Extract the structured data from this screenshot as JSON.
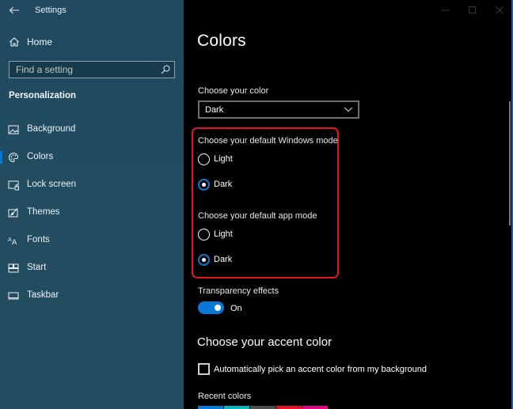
{
  "window": {
    "title": "Settings",
    "controls": {
      "minimize": "minimize",
      "maximize": "maximize",
      "close": "close"
    }
  },
  "sidebar": {
    "home_label": "Home",
    "search": {
      "placeholder": "Find a setting",
      "value": ""
    },
    "section_title": "Personalization",
    "items": [
      {
        "label": "Background",
        "icon": "picture-icon",
        "selected": false
      },
      {
        "label": "Colors",
        "icon": "palette-icon",
        "selected": true
      },
      {
        "label": "Lock screen",
        "icon": "lock-screen-icon",
        "selected": false
      },
      {
        "label": "Themes",
        "icon": "themes-icon",
        "selected": false
      },
      {
        "label": "Fonts",
        "icon": "fonts-icon",
        "selected": false
      },
      {
        "label": "Start",
        "icon": "start-icon",
        "selected": false
      },
      {
        "label": "Taskbar",
        "icon": "taskbar-icon",
        "selected": false
      }
    ]
  },
  "main": {
    "page_title": "Colors",
    "choose_color": {
      "label": "Choose your color",
      "selected": "Dark"
    },
    "windows_mode": {
      "label": "Choose your default Windows mode",
      "options": [
        {
          "label": "Light",
          "checked": false
        },
        {
          "label": "Dark",
          "checked": true
        }
      ]
    },
    "app_mode": {
      "label": "Choose your default app mode",
      "options": [
        {
          "label": "Light",
          "checked": false
        },
        {
          "label": "Dark",
          "checked": true
        }
      ]
    },
    "transparency": {
      "label": "Transparency effects",
      "state": "On",
      "on": true
    },
    "accent": {
      "heading": "Choose your accent color",
      "auto_pick_label": "Automatically pick an accent color from my background",
      "auto_pick_checked": false,
      "recent_label": "Recent colors",
      "recent_colors": [
        "#0a78d7",
        "#00b4c4",
        "#4c4c4c",
        "#e81123",
        "#e3008c"
      ]
    }
  },
  "colors": {
    "accent": "#0a78d7",
    "highlight_box": "#e8141c"
  }
}
